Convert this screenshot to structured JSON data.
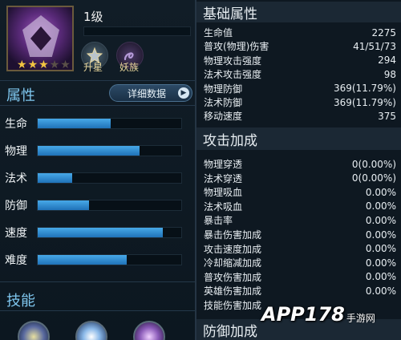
{
  "hero": {
    "level": "1级",
    "stars_on": 3,
    "stars_total": 5,
    "badge_upgrade_label": "升星",
    "badge_race_label": "妖族"
  },
  "attributes": {
    "title": "属性",
    "detail_button": "详细数据",
    "stats": [
      {
        "name": "生命",
        "fraction": 0.51
      },
      {
        "name": "物理",
        "fraction": 0.71
      },
      {
        "name": "法术",
        "fraction": 0.24
      },
      {
        "name": "防御",
        "fraction": 0.36
      },
      {
        "name": "速度",
        "fraction": 0.87
      },
      {
        "name": "难度",
        "fraction": 0.62
      }
    ]
  },
  "skills": {
    "title": "技能"
  },
  "base_attributes": {
    "title": "基础属性",
    "rows": [
      {
        "label": "生命值",
        "value": "2275"
      },
      {
        "label": "普攻(物理)伤害",
        "value": "41/51/73"
      },
      {
        "label": "物理攻击强度",
        "value": "294"
      },
      {
        "label": "法术攻击强度",
        "value": "98"
      },
      {
        "label": "物理防御",
        "value": "369(11.79%)"
      },
      {
        "label": "法术防御",
        "value": "369(11.79%)"
      },
      {
        "label": "移动速度",
        "value": "375"
      }
    ]
  },
  "attack_bonus": {
    "title": "攻击加成",
    "rows": [
      {
        "label": "物理穿透",
        "value": "0(0.00%)"
      },
      {
        "label": "法术穿透",
        "value": "0(0.00%)"
      },
      {
        "label": "物理吸血",
        "value": "0.00%"
      },
      {
        "label": "法术吸血",
        "value": "0.00%"
      },
      {
        "label": "暴击率",
        "value": "0.00%"
      },
      {
        "label": "暴击伤害加成",
        "value": "0.00%"
      },
      {
        "label": "攻击速度加成",
        "value": "0.00%"
      },
      {
        "label": "冷却缩减加成",
        "value": "0.00%"
      },
      {
        "label": "普攻伤害加成",
        "value": "0.00%"
      },
      {
        "label": "英雄伤害加成",
        "value": "0.00%"
      },
      {
        "label": "技能伤害加成",
        "value": ""
      }
    ]
  },
  "defense_bonus": {
    "title": "防御加成"
  },
  "watermark": {
    "brand": "APP178",
    "suffix": "手游网"
  },
  "colors": {
    "accent": "#7fc7ef",
    "bar_fill": "#2f8cd4",
    "star": "#f2c541"
  }
}
